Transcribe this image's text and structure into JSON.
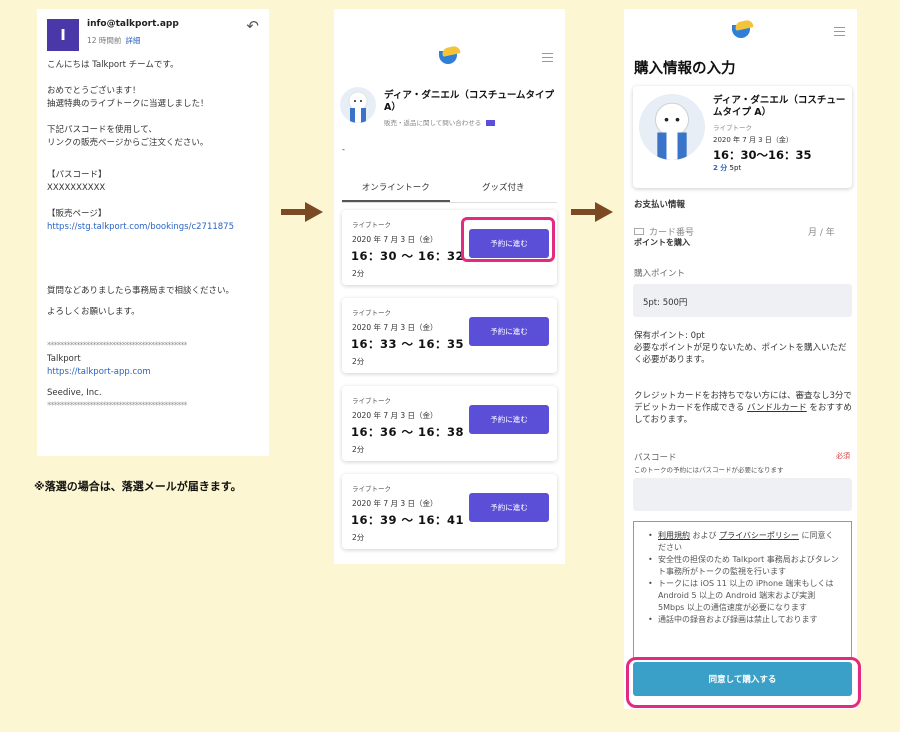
{
  "note": "※落選の場合は、落選メールが届きます。",
  "colors": {
    "background": "#fdf6d2",
    "arrow": "#7a4a25",
    "highlight": "#e42a7e",
    "reserve_button": "#5a4fd6",
    "buy_button": "#3aa0c8",
    "avatar": "#4a37a8"
  },
  "email": {
    "avatar_letter": "I",
    "from": "info@talkport.app",
    "time": "12 時間前",
    "detail_link": "詳細",
    "greeting": "こんにちは Talkport チームです。",
    "congrats_1": "おめでとうございます！",
    "congrats_2": "抽選特典のライブトークに当選しました！",
    "instr_1": "下記パスコードを使用して、",
    "instr_2": "リンクの販売ページからご注文ください。",
    "passcode_label": "【パスコード】",
    "passcode_value": "XXXXXXXXXX",
    "sales_label": "【販売ページ】",
    "sales_url": "https://stg.talkport.com/bookings/c2711875",
    "contact": "質問などありましたら事務局まで相談ください。",
    "regards": "よろしくお願いします。",
    "divider": "************************************************************",
    "company": "Talkport",
    "company_url": "https://talkport-app.com",
    "corp": "Seedive, Inc."
  },
  "list": {
    "performer": "ディア・ダニエル（コスチュームタイプA）",
    "performer_sub": "販売・返品に関して問い合わせる",
    "dash": "-",
    "tabs": [
      {
        "label": "オンライントーク"
      },
      {
        "label": "グッズ付き"
      }
    ],
    "slots": [
      {
        "type": "ライブトーク",
        "date": "2020 年 7 月 3 日（金）",
        "time": "16：30 ～ 16：32",
        "duration": "2分",
        "button": "予約に進む"
      },
      {
        "type": "ライブトーク",
        "date": "2020 年 7 月 3 日（金）",
        "time": "16：33 ～ 16：35",
        "duration": "2分",
        "button": "予約に進む"
      },
      {
        "type": "ライブトーク",
        "date": "2020 年 7 月 3 日（金）",
        "time": "16：36 ～ 16：38",
        "duration": "2分",
        "button": "予約に進む"
      },
      {
        "type": "ライブトーク",
        "date": "2020 年 7 月 3 日（金）",
        "time": "16：39 ～ 16：41",
        "duration": "2分",
        "button": "予約に進む"
      }
    ]
  },
  "form": {
    "title": "購入情報の入力",
    "performer": "ディア・ダニエル（コスチュームタイプ A）",
    "type": "ライブトーク",
    "date": "2020 年 7 月 3 日（金）",
    "time": "16：30～16：35",
    "duration": "2 分",
    "points": "5pt",
    "payment_label": "お支払い情報",
    "card_placeholder": "カード番号",
    "card_expiry": "月 / 年",
    "buy_points_label": "ポイントを購入",
    "purchase_points_label": "購入ポイント",
    "purchase_points_value": "5pt: 500円",
    "owned_points": "保有ポイント: 0pt",
    "insufficient_note": "必要なポイントが足りないため、ポイントを購入いただく必要があります。",
    "card_note_1": "クレジットカードをお持ちでない方には、審査なし3分でデビットカードを作成できる ",
    "card_note_link": "バンドルカード",
    "card_note_2": " をおすすめしております。",
    "passcode_label": "パスコード",
    "passcode_required": "必須",
    "passcode_note": "このトークの予約にはパスコードが必要になります",
    "terms_link_1": "利用規約",
    "terms_and": " および ",
    "terms_link_2": "プライバシーポリシー",
    "terms_1_rest": " に同意ください",
    "terms_2": "安全性の担保のため Talkport 事務局およびタレント事務所がトークの監視を行います",
    "terms_3": "トークには iOS 11 以上の iPhone 端末もしくは Android 5 以上の Android 端末および実測 5Mbps 以上の通信速度が必要になります",
    "terms_4": "通話中の録音および録画は禁止しております",
    "buy_button": "同意して購入する"
  }
}
